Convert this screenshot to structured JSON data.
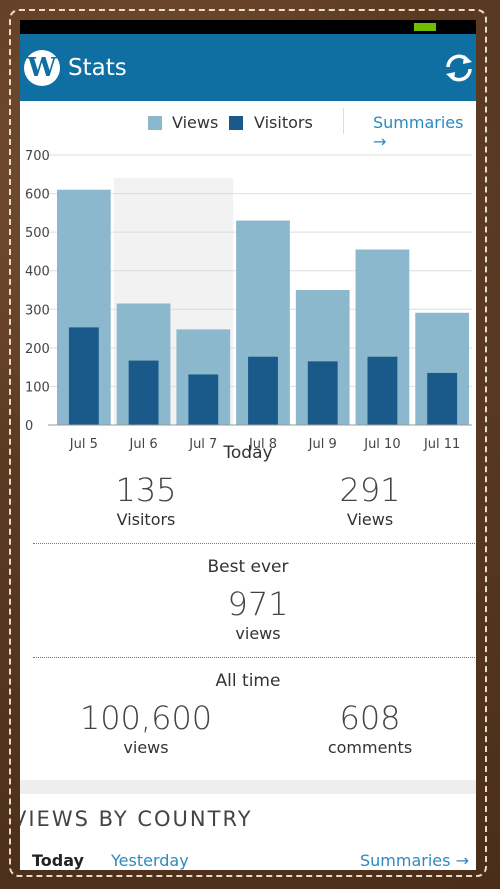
{
  "app": {
    "title": "Stats",
    "logo": "W"
  },
  "legend": {
    "views_label": "Views",
    "visitors_label": "Visitors",
    "summaries_label": "Summaries →"
  },
  "colors": {
    "appbar": "#0f6fa3",
    "views": "#8bb8cc",
    "visitors": "#1a5a8a",
    "link": "#2b8ac0"
  },
  "chart_data": {
    "type": "bar",
    "categories": [
      "Jul 5",
      "Jul 6",
      "Jul 7",
      "Jul 8",
      "Jul 9",
      "Jul 10",
      "Jul 11"
    ],
    "series": [
      {
        "name": "Views",
        "values": [
          610,
          315,
          248,
          530,
          350,
          455,
          291
        ]
      },
      {
        "name": "Visitors",
        "values": [
          253,
          167,
          131,
          177,
          165,
          177,
          135
        ]
      }
    ],
    "yticks": [
      "0",
      "100",
      "200",
      "300",
      "400",
      "500",
      "600",
      "700"
    ],
    "ylim": [
      0,
      700
    ],
    "grid": true,
    "legend": "top"
  },
  "today": {
    "title": "Today",
    "visitors_value": "135",
    "visitors_label": "Visitors",
    "views_value": "291",
    "views_label": "Views"
  },
  "best": {
    "title": "Best ever",
    "value": "971",
    "label": "views"
  },
  "alltime": {
    "title": "All time",
    "views_value": "100,600",
    "views_label": "views",
    "comments_value": "608",
    "comments_label": "comments"
  },
  "country": {
    "title": "VIEWS BY COUNTRY",
    "tab_today": "Today",
    "tab_yesterday": "Yesterday",
    "summaries": "Summaries →"
  }
}
